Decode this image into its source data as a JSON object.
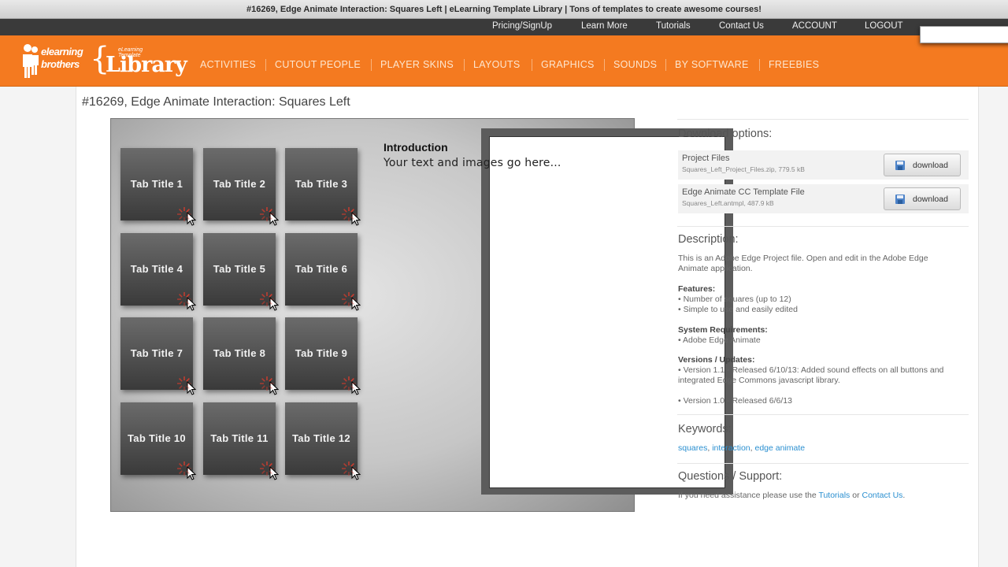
{
  "window_title": "#16269, Edge Animate Interaction: Squares Left | eLearning Template Library | Tons of templates to create awesome courses!",
  "utility_links": [
    "Pricing/SignUp",
    "Learn More",
    "Tutorials",
    "Contact Us",
    "ACCOUNT",
    "LOGOUT"
  ],
  "logo": {
    "line1": "elearning",
    "line2": "brothers",
    "small": "eLearning Template",
    "library": "Library",
    "brace": "{"
  },
  "nav": [
    "ACTIVITIES",
    "CUTOUT PEOPLE",
    "PLAYER SKINS",
    "LAYOUTS",
    "GRAPHICS",
    "SOUNDS",
    "BY SOFTWARE",
    "FREEBIES"
  ],
  "page_title": "#16269, Edge Animate Interaction: Squares Left",
  "preview": {
    "tiles": [
      "Tab Title 1",
      "Tab Title 2",
      "Tab Title 3",
      "Tab Title 4",
      "Tab Title 5",
      "Tab Title 6",
      "Tab Title 7",
      "Tab Title 8",
      "Tab Title 9",
      "Tab Title 10",
      "Tab Title 11",
      "Tab Title 12"
    ],
    "content_title": "Introduction",
    "content_body": "Your text and images go here..."
  },
  "download": {
    "heading": "Download options:",
    "items": [
      {
        "name": "Project Files",
        "file": "Squares_Left_Project_Files.zip, 779.5 kB",
        "button": "download"
      },
      {
        "name": "Edge Animate CC Template File",
        "file": "Squares_Left.antmpl, 487.9 kB",
        "button": "download"
      }
    ]
  },
  "description": {
    "heading": "Description:",
    "text1": "This is an Adobe Edge Project file. Open and edit in the Adobe Edge",
    "text2": "Animate application.",
    "features_label": "Features:",
    "features": [
      "• Number of squares (up to 12)",
      "• Simple to use and easily edited"
    ],
    "sysreq_label": "System Requirements:",
    "sysreq": [
      "• Adobe Edge Animate"
    ],
    "versions_label": "Versions / Updates:",
    "versions": [
      "• Version 1.1 - Released 6/10/13: Added sound effects on all buttons and",
      "integrated Edge Commons javascript library.",
      "• Version 1.0 - Released 6/6/13"
    ]
  },
  "keywords": {
    "heading": "Keywords:",
    "items": [
      "squares",
      "interaction",
      "edge animate"
    ],
    "sep": ", "
  },
  "support": {
    "heading": "Questions / Support:",
    "prefix": "If you need assistance please use the ",
    "tutorials": "Tutorials",
    "or": " or ",
    "contact": "Contact Us",
    "suffix": "."
  },
  "colors": {
    "header_orange": "#f47a20",
    "utility_bar": "#3a3a3a",
    "link_blue": "#2a8fd0"
  }
}
